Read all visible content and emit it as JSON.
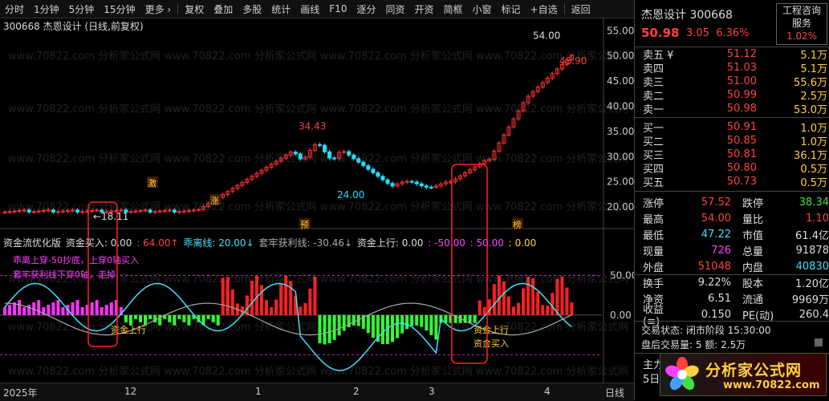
{
  "toolbar": {
    "items": [
      "分时",
      "1分钟",
      "5分钟",
      "15分钟",
      "更多 ›",
      "复权",
      "叠加",
      "多股",
      "统计",
      "画线",
      "F10",
      "逐分",
      "同资",
      "开资",
      "简框",
      "小窗",
      "标记",
      "+自选",
      "返回"
    ]
  },
  "chart_header": {
    "code": "300668",
    "name": "杰恩设计",
    "mode": "(日线,前复权)"
  },
  "price_labels": {
    "high": "34.43",
    "low": "24.00",
    "peak": "54.00",
    "peak2": "48.90",
    "start": "18.11"
  },
  "markers": [
    "激",
    "涨",
    "预",
    "榜"
  ],
  "indicator": {
    "name": "资金流优化版",
    "f1": "资金买入: 0.00",
    "f2": ": 64.00↑",
    "f3": "乖离线: 20.00↓",
    "f4": "套牢获利线: -30.46↓",
    "f5": "资金上行: 0.00",
    "f6": ": -50.00",
    "f7": ": 50.00",
    "f8": ": 0.00",
    "note1": "乖离上穿-50抄底，上穿0轴买入",
    "note2": "套牢获利线下穿0轴，走掉",
    "label_up": "资金上行",
    "label_buy": "资金买入"
  },
  "price_axis": [
    "55.00",
    "50.00",
    "45.00",
    "40.00",
    "35.00",
    "30.00",
    "25.00",
    "20.00"
  ],
  "ind_axis": [
    "50.00",
    "0.00"
  ],
  "time_axis": [
    {
      "label": "2025年",
      "pos": 4
    },
    {
      "label": "12",
      "pos": 155
    },
    {
      "label": "1",
      "pos": 318
    },
    {
      "label": "2",
      "pos": 440
    },
    {
      "label": "3",
      "pos": 534
    },
    {
      "label": "4",
      "pos": 678
    },
    {
      "label": "日线",
      "pos": 754
    }
  ],
  "quote": {
    "title": "杰恩设计 300668",
    "price": "50.98",
    "change": "3.05",
    "pct": "6.36%",
    "badge1": "工程咨询",
    "badge2": "服务",
    "badge_pct": "1.02%",
    "sells": [
      {
        "label": "卖五 ¥",
        "price": "51.12",
        "vol": "5.1万"
      },
      {
        "label": "卖四",
        "price": "51.03",
        "vol": "5.1万"
      },
      {
        "label": "卖三",
        "price": "51.00",
        "vol": "55.6万"
      },
      {
        "label": "卖二",
        "price": "50.99",
        "vol": "2.5万"
      },
      {
        "label": "卖一",
        "price": "50.98",
        "vol": "53.0万"
      }
    ],
    "buys": [
      {
        "label": "买一",
        "price": "50.91",
        "vol": "1.0万"
      },
      {
        "label": "买二",
        "price": "50.85",
        "vol": "1.0万"
      },
      {
        "label": "买三",
        "price": "50.81",
        "vol": "36.1万"
      },
      {
        "label": "买四",
        "price": "50.80",
        "vol": "0.5万"
      },
      {
        "label": "买五",
        "price": "50.73",
        "vol": "0.5万"
      }
    ],
    "stats": [
      {
        "k1": "涨停",
        "v1": "57.52",
        "c1": "red",
        "k2": "跌停",
        "v2": "38.34",
        "c2": "green"
      },
      {
        "k1": "最高",
        "v1": "54.00",
        "c1": "red",
        "k2": "量比",
        "v2": "1.10",
        "c2": "red"
      },
      {
        "k1": "最低",
        "v1": "47.22",
        "c1": "cyan",
        "k2": "市值",
        "v2": "61.4亿",
        "c2": "white"
      },
      {
        "k1": "现量",
        "v1": "726",
        "c1": "magenta",
        "k2": "总量",
        "v2": "91878",
        "c2": "white"
      },
      {
        "k1": "外盘",
        "v1": "51048",
        "c1": "red",
        "k2": "内盘",
        "v2": "40830",
        "c2": "cyan"
      }
    ],
    "stats2": [
      {
        "k1": "换手",
        "v1": "9.22%",
        "k2": "股本",
        "v2": "1.20亿"
      },
      {
        "k1": "净资",
        "v1": "6.51",
        "k2": "流通",
        "v2": "9969万"
      },
      {
        "k1": "收益(≡)",
        "v1": "0.150",
        "k2": "PE(动)",
        "v2": "260.4"
      }
    ],
    "trade_status": "交易状态: 闭市阶段 15:30:00",
    "after_hours": "盘后交易量: 5  额: 2.5万",
    "bottom1": "主力",
    "bottom2": "5日"
  },
  "logo": {
    "text1": "分析家公式网",
    "text2": "www.70822.com"
  },
  "watermark": "www.70822.com 分析家公式网",
  "colors": {
    "up": "#ff3030",
    "down": "#20e0ff",
    "green_bar": "#30ff30",
    "magenta": "#ff30ff"
  }
}
